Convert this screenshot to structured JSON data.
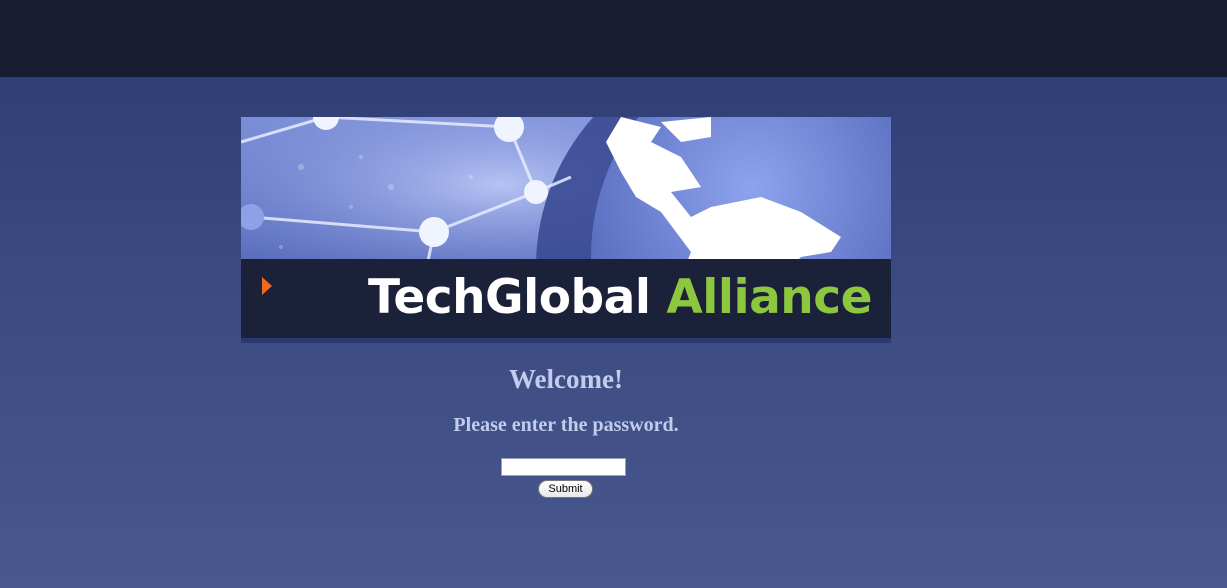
{
  "banner": {
    "brand_part1": "TechGlobal",
    "brand_part2": "Alliance",
    "accent_color": "#8dc63f",
    "arrow_color": "#f26a1b"
  },
  "main": {
    "heading": "Welcome!",
    "prompt": "Please enter the password.",
    "password_value": "",
    "submit_label": "Submit"
  },
  "icons": [
    "arrow-right-icon",
    "globe-icon"
  ]
}
